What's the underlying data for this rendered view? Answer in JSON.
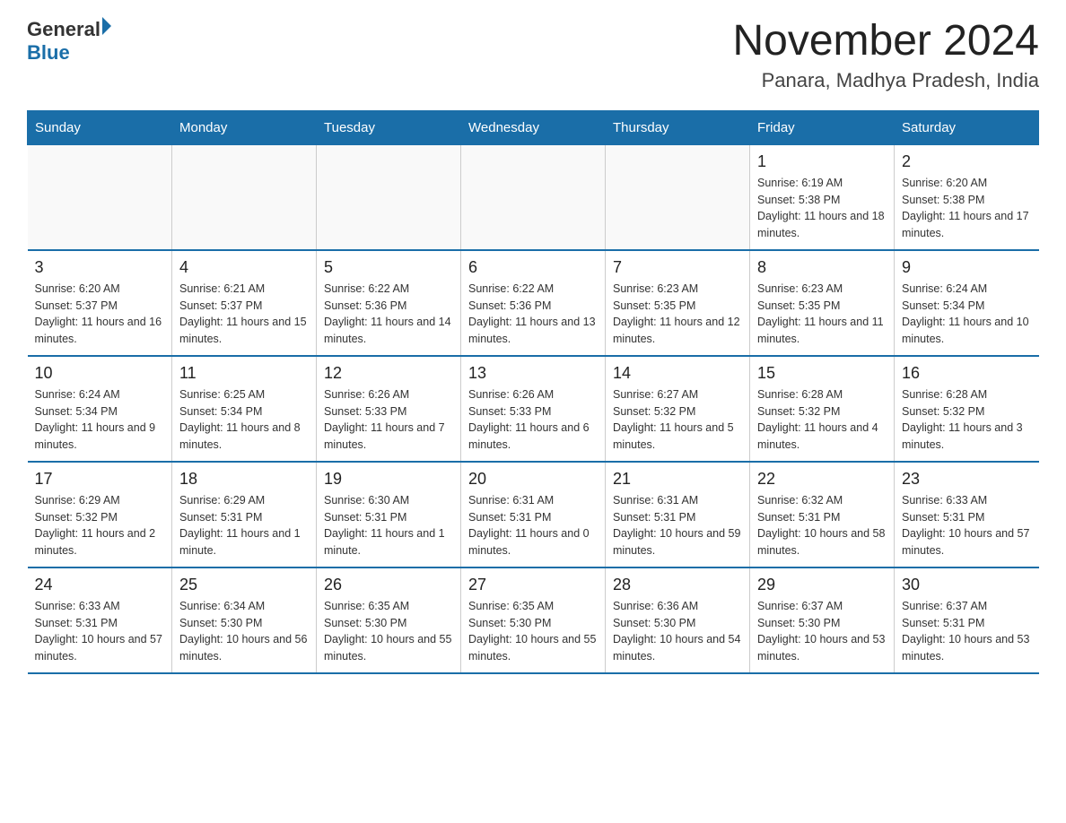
{
  "header": {
    "logo_general": "General",
    "logo_blue": "Blue",
    "title": "November 2024",
    "subtitle": "Panara, Madhya Pradesh, India"
  },
  "weekdays": [
    "Sunday",
    "Monday",
    "Tuesday",
    "Wednesday",
    "Thursday",
    "Friday",
    "Saturday"
  ],
  "weeks": [
    [
      {
        "day": "",
        "sunrise": "",
        "sunset": "",
        "daylight": ""
      },
      {
        "day": "",
        "sunrise": "",
        "sunset": "",
        "daylight": ""
      },
      {
        "day": "",
        "sunrise": "",
        "sunset": "",
        "daylight": ""
      },
      {
        "day": "",
        "sunrise": "",
        "sunset": "",
        "daylight": ""
      },
      {
        "day": "",
        "sunrise": "",
        "sunset": "",
        "daylight": ""
      },
      {
        "day": "1",
        "sunrise": "Sunrise: 6:19 AM",
        "sunset": "Sunset: 5:38 PM",
        "daylight": "Daylight: 11 hours and 18 minutes."
      },
      {
        "day": "2",
        "sunrise": "Sunrise: 6:20 AM",
        "sunset": "Sunset: 5:38 PM",
        "daylight": "Daylight: 11 hours and 17 minutes."
      }
    ],
    [
      {
        "day": "3",
        "sunrise": "Sunrise: 6:20 AM",
        "sunset": "Sunset: 5:37 PM",
        "daylight": "Daylight: 11 hours and 16 minutes."
      },
      {
        "day": "4",
        "sunrise": "Sunrise: 6:21 AM",
        "sunset": "Sunset: 5:37 PM",
        "daylight": "Daylight: 11 hours and 15 minutes."
      },
      {
        "day": "5",
        "sunrise": "Sunrise: 6:22 AM",
        "sunset": "Sunset: 5:36 PM",
        "daylight": "Daylight: 11 hours and 14 minutes."
      },
      {
        "day": "6",
        "sunrise": "Sunrise: 6:22 AM",
        "sunset": "Sunset: 5:36 PM",
        "daylight": "Daylight: 11 hours and 13 minutes."
      },
      {
        "day": "7",
        "sunrise": "Sunrise: 6:23 AM",
        "sunset": "Sunset: 5:35 PM",
        "daylight": "Daylight: 11 hours and 12 minutes."
      },
      {
        "day": "8",
        "sunrise": "Sunrise: 6:23 AM",
        "sunset": "Sunset: 5:35 PM",
        "daylight": "Daylight: 11 hours and 11 minutes."
      },
      {
        "day": "9",
        "sunrise": "Sunrise: 6:24 AM",
        "sunset": "Sunset: 5:34 PM",
        "daylight": "Daylight: 11 hours and 10 minutes."
      }
    ],
    [
      {
        "day": "10",
        "sunrise": "Sunrise: 6:24 AM",
        "sunset": "Sunset: 5:34 PM",
        "daylight": "Daylight: 11 hours and 9 minutes."
      },
      {
        "day": "11",
        "sunrise": "Sunrise: 6:25 AM",
        "sunset": "Sunset: 5:34 PM",
        "daylight": "Daylight: 11 hours and 8 minutes."
      },
      {
        "day": "12",
        "sunrise": "Sunrise: 6:26 AM",
        "sunset": "Sunset: 5:33 PM",
        "daylight": "Daylight: 11 hours and 7 minutes."
      },
      {
        "day": "13",
        "sunrise": "Sunrise: 6:26 AM",
        "sunset": "Sunset: 5:33 PM",
        "daylight": "Daylight: 11 hours and 6 minutes."
      },
      {
        "day": "14",
        "sunrise": "Sunrise: 6:27 AM",
        "sunset": "Sunset: 5:32 PM",
        "daylight": "Daylight: 11 hours and 5 minutes."
      },
      {
        "day": "15",
        "sunrise": "Sunrise: 6:28 AM",
        "sunset": "Sunset: 5:32 PM",
        "daylight": "Daylight: 11 hours and 4 minutes."
      },
      {
        "day": "16",
        "sunrise": "Sunrise: 6:28 AM",
        "sunset": "Sunset: 5:32 PM",
        "daylight": "Daylight: 11 hours and 3 minutes."
      }
    ],
    [
      {
        "day": "17",
        "sunrise": "Sunrise: 6:29 AM",
        "sunset": "Sunset: 5:32 PM",
        "daylight": "Daylight: 11 hours and 2 minutes."
      },
      {
        "day": "18",
        "sunrise": "Sunrise: 6:29 AM",
        "sunset": "Sunset: 5:31 PM",
        "daylight": "Daylight: 11 hours and 1 minute."
      },
      {
        "day": "19",
        "sunrise": "Sunrise: 6:30 AM",
        "sunset": "Sunset: 5:31 PM",
        "daylight": "Daylight: 11 hours and 1 minute."
      },
      {
        "day": "20",
        "sunrise": "Sunrise: 6:31 AM",
        "sunset": "Sunset: 5:31 PM",
        "daylight": "Daylight: 11 hours and 0 minutes."
      },
      {
        "day": "21",
        "sunrise": "Sunrise: 6:31 AM",
        "sunset": "Sunset: 5:31 PM",
        "daylight": "Daylight: 10 hours and 59 minutes."
      },
      {
        "day": "22",
        "sunrise": "Sunrise: 6:32 AM",
        "sunset": "Sunset: 5:31 PM",
        "daylight": "Daylight: 10 hours and 58 minutes."
      },
      {
        "day": "23",
        "sunrise": "Sunrise: 6:33 AM",
        "sunset": "Sunset: 5:31 PM",
        "daylight": "Daylight: 10 hours and 57 minutes."
      }
    ],
    [
      {
        "day": "24",
        "sunrise": "Sunrise: 6:33 AM",
        "sunset": "Sunset: 5:31 PM",
        "daylight": "Daylight: 10 hours and 57 minutes."
      },
      {
        "day": "25",
        "sunrise": "Sunrise: 6:34 AM",
        "sunset": "Sunset: 5:30 PM",
        "daylight": "Daylight: 10 hours and 56 minutes."
      },
      {
        "day": "26",
        "sunrise": "Sunrise: 6:35 AM",
        "sunset": "Sunset: 5:30 PM",
        "daylight": "Daylight: 10 hours and 55 minutes."
      },
      {
        "day": "27",
        "sunrise": "Sunrise: 6:35 AM",
        "sunset": "Sunset: 5:30 PM",
        "daylight": "Daylight: 10 hours and 55 minutes."
      },
      {
        "day": "28",
        "sunrise": "Sunrise: 6:36 AM",
        "sunset": "Sunset: 5:30 PM",
        "daylight": "Daylight: 10 hours and 54 minutes."
      },
      {
        "day": "29",
        "sunrise": "Sunrise: 6:37 AM",
        "sunset": "Sunset: 5:30 PM",
        "daylight": "Daylight: 10 hours and 53 minutes."
      },
      {
        "day": "30",
        "sunrise": "Sunrise: 6:37 AM",
        "sunset": "Sunset: 5:31 PM",
        "daylight": "Daylight: 10 hours and 53 minutes."
      }
    ]
  ]
}
